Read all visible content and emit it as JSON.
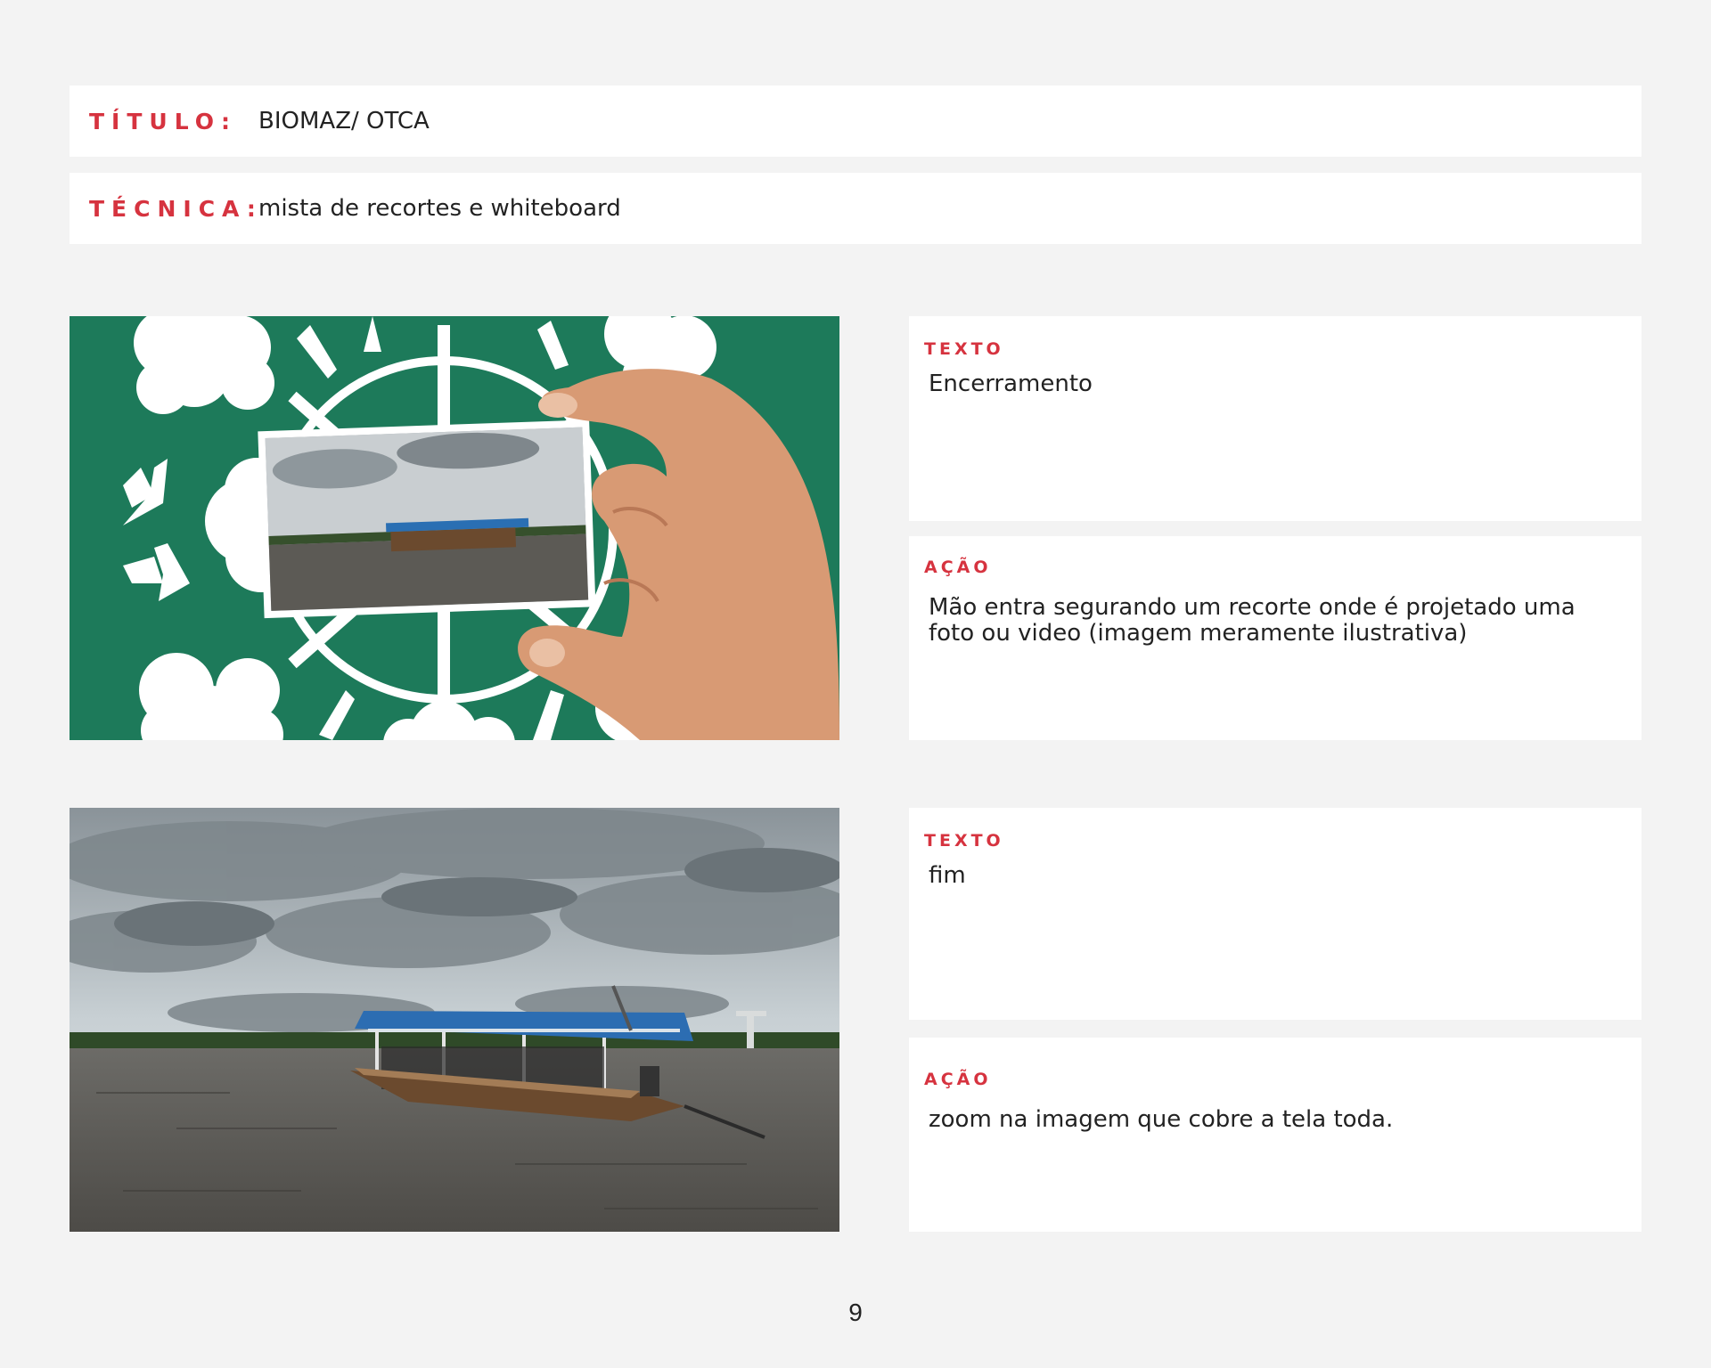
{
  "header": {
    "titulo_label": "TÍTULO:",
    "titulo_value": "BIOMAZ/ OTCA",
    "tecnica_label": "TÉCNICA:",
    "tecnica_value": "mista de recortes e whiteboard"
  },
  "scenes": [
    {
      "texto_label": "TEXTO",
      "texto": "Encerramento",
      "acao_label": "AÇÃO",
      "acao": "Mão entra segurando um recorte onde é projetado uma foto ou video (imagem meramente ilustrativa)"
    },
    {
      "texto_label": "TEXTO",
      "texto": "fim",
      "acao_label": "AÇÃO",
      "acao": "zoom na imagem que cobre a tela toda."
    }
  ],
  "page_number": "9",
  "colors": {
    "accent": "#d6333f",
    "background": "#f3f3f3",
    "card": "#ffffff",
    "panel_green": "#1d7a5a"
  }
}
